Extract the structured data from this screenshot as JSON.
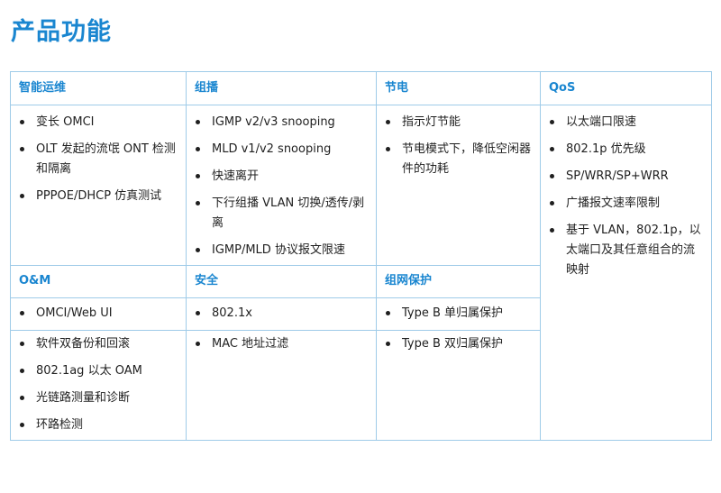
{
  "page_title": "产品功能",
  "sections": {
    "ops": {
      "header": "智能运维",
      "items": [
        "变长 OMCI",
        "OLT 发起的流氓 ONT 检测和隔离",
        "PPPOE/DHCP 仿真测试"
      ]
    },
    "multicast": {
      "header": "组播",
      "items": [
        "IGMP v2/v3 snooping",
        "MLD v1/v2 snooping",
        "快速离开",
        "下行组播 VLAN 切换/透传/剥离",
        "IGMP/MLD 协议报文限速"
      ]
    },
    "power": {
      "header": "节电",
      "items": [
        "指示灯节能",
        "节电模式下，降低空闲器件的功耗"
      ]
    },
    "qos": {
      "header": "QoS",
      "items": [
        "以太端口限速",
        "802.1p 优先级",
        "SP/WRR/SP+WRR",
        "广播报文速率限制",
        "基于 VLAN，802.1p，以太端口及其任意组合的流映射"
      ]
    },
    "oam": {
      "header": "O&M",
      "items_top": [
        "OMCI/Web UI"
      ],
      "items_bottom": [
        "软件双备份和回滚",
        "802.1ag 以太 OAM",
        "光链路测量和诊断",
        "环路检测"
      ]
    },
    "security": {
      "header": "安全",
      "items_top": [
        "802.1x"
      ],
      "items_bottom": [
        "MAC 地址过滤"
      ]
    },
    "protection": {
      "header": "组网保护",
      "items_top": [
        "Type B 单归属保护"
      ],
      "items_bottom": [
        "Type B 双归属保护"
      ]
    }
  }
}
